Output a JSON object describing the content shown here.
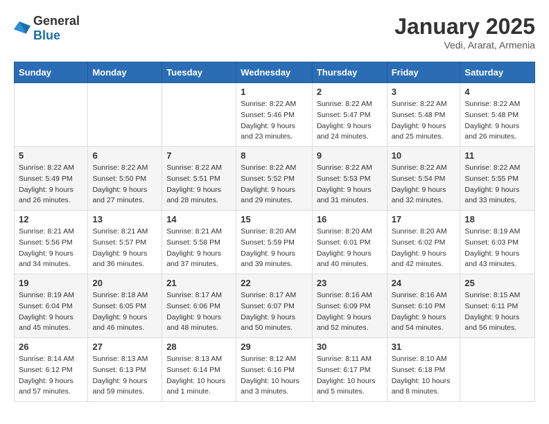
{
  "logo": {
    "general": "General",
    "blue": "Blue"
  },
  "title": {
    "month_year": "January 2025",
    "location": "Vedi, Ararat, Armenia"
  },
  "weekdays": [
    "Sunday",
    "Monday",
    "Tuesday",
    "Wednesday",
    "Thursday",
    "Friday",
    "Saturday"
  ],
  "weeks": [
    [
      {
        "day": "",
        "info": ""
      },
      {
        "day": "",
        "info": ""
      },
      {
        "day": "",
        "info": ""
      },
      {
        "day": "1",
        "info": "Sunrise: 8:22 AM\nSunset: 5:46 PM\nDaylight: 9 hours\nand 23 minutes."
      },
      {
        "day": "2",
        "info": "Sunrise: 8:22 AM\nSunset: 5:47 PM\nDaylight: 9 hours\nand 24 minutes."
      },
      {
        "day": "3",
        "info": "Sunrise: 8:22 AM\nSunset: 5:48 PM\nDaylight: 9 hours\nand 25 minutes."
      },
      {
        "day": "4",
        "info": "Sunrise: 8:22 AM\nSunset: 5:48 PM\nDaylight: 9 hours\nand 26 minutes."
      }
    ],
    [
      {
        "day": "5",
        "info": "Sunrise: 8:22 AM\nSunset: 5:49 PM\nDaylight: 9 hours\nand 26 minutes."
      },
      {
        "day": "6",
        "info": "Sunrise: 8:22 AM\nSunset: 5:50 PM\nDaylight: 9 hours\nand 27 minutes."
      },
      {
        "day": "7",
        "info": "Sunrise: 8:22 AM\nSunset: 5:51 PM\nDaylight: 9 hours\nand 28 minutes."
      },
      {
        "day": "8",
        "info": "Sunrise: 8:22 AM\nSunset: 5:52 PM\nDaylight: 9 hours\nand 29 minutes."
      },
      {
        "day": "9",
        "info": "Sunrise: 8:22 AM\nSunset: 5:53 PM\nDaylight: 9 hours\nand 31 minutes."
      },
      {
        "day": "10",
        "info": "Sunrise: 8:22 AM\nSunset: 5:54 PM\nDaylight: 9 hours\nand 32 minutes."
      },
      {
        "day": "11",
        "info": "Sunrise: 8:22 AM\nSunset: 5:55 PM\nDaylight: 9 hours\nand 33 minutes."
      }
    ],
    [
      {
        "day": "12",
        "info": "Sunrise: 8:21 AM\nSunset: 5:56 PM\nDaylight: 9 hours\nand 34 minutes."
      },
      {
        "day": "13",
        "info": "Sunrise: 8:21 AM\nSunset: 5:57 PM\nDaylight: 9 hours\nand 36 minutes."
      },
      {
        "day": "14",
        "info": "Sunrise: 8:21 AM\nSunset: 5:58 PM\nDaylight: 9 hours\nand 37 minutes."
      },
      {
        "day": "15",
        "info": "Sunrise: 8:20 AM\nSunset: 5:59 PM\nDaylight: 9 hours\nand 39 minutes."
      },
      {
        "day": "16",
        "info": "Sunrise: 8:20 AM\nSunset: 6:01 PM\nDaylight: 9 hours\nand 40 minutes."
      },
      {
        "day": "17",
        "info": "Sunrise: 8:20 AM\nSunset: 6:02 PM\nDaylight: 9 hours\nand 42 minutes."
      },
      {
        "day": "18",
        "info": "Sunrise: 8:19 AM\nSunset: 6:03 PM\nDaylight: 9 hours\nand 43 minutes."
      }
    ],
    [
      {
        "day": "19",
        "info": "Sunrise: 8:19 AM\nSunset: 6:04 PM\nDaylight: 9 hours\nand 45 minutes."
      },
      {
        "day": "20",
        "info": "Sunrise: 8:18 AM\nSunset: 6:05 PM\nDaylight: 9 hours\nand 46 minutes."
      },
      {
        "day": "21",
        "info": "Sunrise: 8:17 AM\nSunset: 6:06 PM\nDaylight: 9 hours\nand 48 minutes."
      },
      {
        "day": "22",
        "info": "Sunrise: 8:17 AM\nSunset: 6:07 PM\nDaylight: 9 hours\nand 50 minutes."
      },
      {
        "day": "23",
        "info": "Sunrise: 8:16 AM\nSunset: 6:09 PM\nDaylight: 9 hours\nand 52 minutes."
      },
      {
        "day": "24",
        "info": "Sunrise: 8:16 AM\nSunset: 6:10 PM\nDaylight: 9 hours\nand 54 minutes."
      },
      {
        "day": "25",
        "info": "Sunrise: 8:15 AM\nSunset: 6:11 PM\nDaylight: 9 hours\nand 56 minutes."
      }
    ],
    [
      {
        "day": "26",
        "info": "Sunrise: 8:14 AM\nSunset: 6:12 PM\nDaylight: 9 hours\nand 57 minutes."
      },
      {
        "day": "27",
        "info": "Sunrise: 8:13 AM\nSunset: 6:13 PM\nDaylight: 9 hours\nand 59 minutes."
      },
      {
        "day": "28",
        "info": "Sunrise: 8:13 AM\nSunset: 6:14 PM\nDaylight: 10 hours\nand 1 minute."
      },
      {
        "day": "29",
        "info": "Sunrise: 8:12 AM\nSunset: 6:16 PM\nDaylight: 10 hours\nand 3 minutes."
      },
      {
        "day": "30",
        "info": "Sunrise: 8:11 AM\nSunset: 6:17 PM\nDaylight: 10 hours\nand 5 minutes."
      },
      {
        "day": "31",
        "info": "Sunrise: 8:10 AM\nSunset: 6:18 PM\nDaylight: 10 hours\nand 8 minutes."
      },
      {
        "day": "",
        "info": ""
      }
    ]
  ]
}
